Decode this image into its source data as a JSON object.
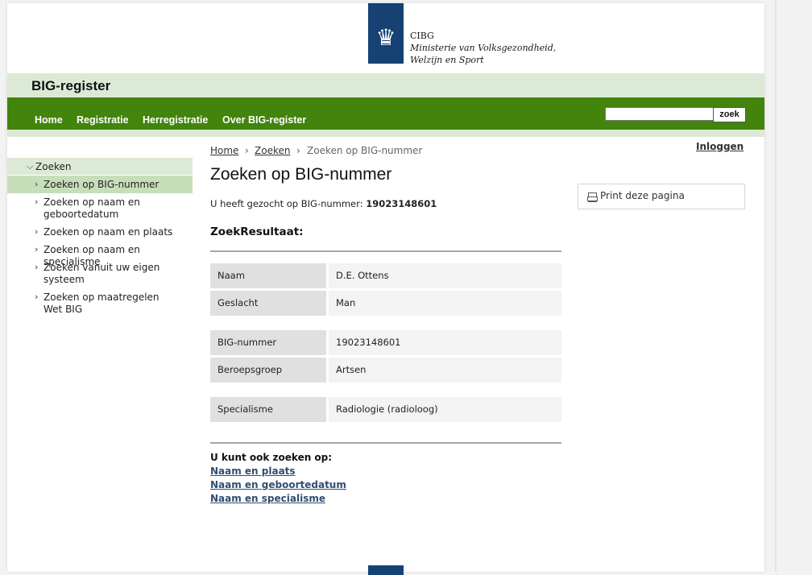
{
  "logo": {
    "org": "CIBG",
    "ministry_line1": "Ministerie van Volksgezondheid,",
    "ministry_line2": "Welzijn en Sport"
  },
  "site_title": "BIG-register",
  "nav": {
    "items": [
      "Home",
      "Registratie",
      "Herregistratie",
      "Over BIG-register"
    ],
    "search_button": "zoek",
    "search_value": ""
  },
  "sidebar": {
    "root": "Zoeken",
    "items": [
      "Zoeken op BIG-nummer",
      "Zoeken op naam en geboortedatum",
      "Zoeken op naam en plaats",
      "Zoeken op naam en specialisme",
      "Zoeken vanuit uw eigen systeem",
      "Zoeken op maatregelen Wet BIG"
    ],
    "active_index": 0
  },
  "breadcrumb": {
    "home": "Home",
    "zoeken": "Zoeken",
    "current": "Zoeken op BIG-nummer"
  },
  "login": "Inloggen",
  "main": {
    "title": "Zoeken op BIG-nummer",
    "searched_prefix": "U heeft gezocht op BIG-nummer:",
    "searched_value": "19023148601",
    "result_heading": "ZoekResultaat:",
    "rows": [
      {
        "label": "Naam",
        "value": "D.E. Ottens"
      },
      {
        "label": "Geslacht",
        "value": "Man"
      },
      {
        "label": "BIG-nummer",
        "value": "19023148601"
      },
      {
        "label": "Beroepsgroep",
        "value": "Artsen"
      },
      {
        "label": "Specialisme",
        "value": "Radiologie (radioloog)"
      }
    ],
    "also_label": "U kunt ook zoeken op:",
    "also_links": [
      "Naam en plaats",
      "Naam en geboortedatum",
      "Naam en specialisme"
    ]
  },
  "print_label": "Print deze pagina",
  "colors": {
    "nav_green": "#42840c",
    "light_green": "#dcead5",
    "active_green": "#c6dfba",
    "logo_blue": "#154273"
  }
}
